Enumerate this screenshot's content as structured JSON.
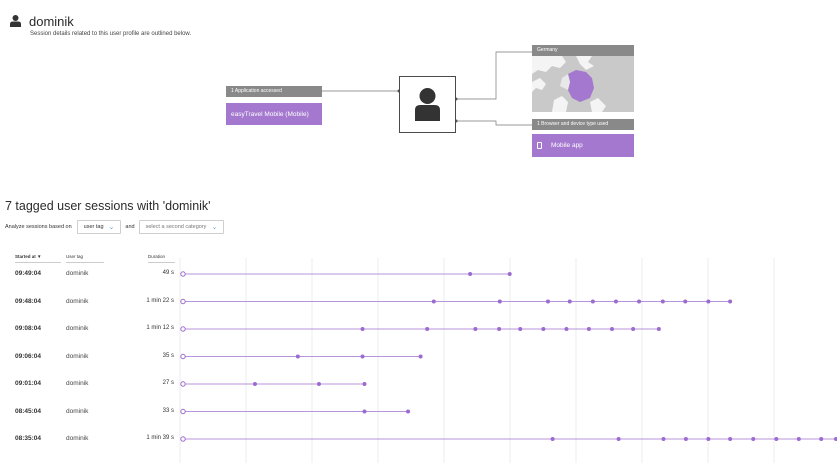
{
  "profile": {
    "username": "dominik",
    "subtitle": "Session details related to this user profile are outlined below."
  },
  "diagram": {
    "apps_label": "1 Application accessed",
    "app_name": "easyTravel Mobile (Mobile)",
    "country_label": "Germany",
    "device_label": "1 Browser and device type used",
    "device_name": "Mobile app"
  },
  "sessions": {
    "title": "7 tagged user sessions with 'dominik'",
    "analyze_label": "Analyze sessions based on",
    "category_select": "user tag",
    "and_label": "and",
    "second_select_placeholder": "select a second category",
    "columns": {
      "started": "Started at ▼",
      "tag": "User tag",
      "duration": "Duration"
    },
    "rows": [
      {
        "started": "09:49:04",
        "tag": "dominik",
        "duration": "49 s",
        "actions": [
          0,
          43.5,
          49.5
        ]
      },
      {
        "started": "09:48:04",
        "tag": "dominik",
        "duration": "1 min 22 s",
        "actions": [
          0,
          38,
          48,
          55.3,
          58.6,
          62.1,
          65.6,
          69.1,
          72.7,
          76.1,
          79.6,
          82.9
        ]
      },
      {
        "started": "09:08:04",
        "tag": "dominik",
        "duration": "1 min 12 s",
        "actions": [
          0,
          27.2,
          37,
          44.3,
          47.9,
          51.1,
          54.6,
          58.1,
          61.5,
          65,
          68.2,
          72.1
        ]
      },
      {
        "started": "09:06:04",
        "tag": "dominik",
        "duration": "35 s",
        "actions": [
          0,
          17.4,
          27.2,
          36
        ]
      },
      {
        "started": "09:01:04",
        "tag": "dominik",
        "duration": "27 s",
        "actions": [
          0,
          10.9,
          20.6,
          27.5
        ]
      },
      {
        "started": "08:45:04",
        "tag": "dominik",
        "duration": "33 s",
        "actions": [
          0,
          27.5,
          34.1
        ]
      },
      {
        "started": "08:35:04",
        "tag": "dominik",
        "duration": "1 min 39 s",
        "actions": [
          0,
          56,
          66,
          72.8,
          76.2,
          79.6,
          82.9,
          86.4,
          89.9,
          93.3,
          96.7,
          99
        ]
      }
    ]
  },
  "colors": {
    "accent": "#a378ce",
    "dot": "#9c6bd0",
    "label_bg": "#898989"
  }
}
